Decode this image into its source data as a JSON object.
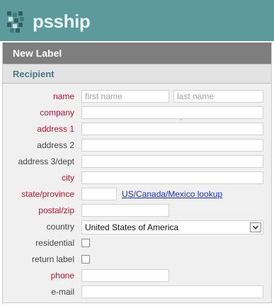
{
  "header": {
    "logo_text": "psship"
  },
  "panel": {
    "title": "New Label"
  },
  "recipient": {
    "section_label": "Recipient",
    "fields": {
      "name": {
        "label": "name",
        "first_placeholder": "first name",
        "last_placeholder": "last name",
        "first_value": "",
        "last_value": ""
      },
      "company": {
        "label": "company",
        "value": ""
      },
      "address1": {
        "label": "address 1",
        "value": ""
      },
      "address2": {
        "label": "address 2",
        "value": ""
      },
      "address3": {
        "label": "address 3/dept",
        "value": ""
      },
      "city": {
        "label": "city",
        "value": ""
      },
      "state": {
        "label": "state/province",
        "value": "",
        "lookup_link": "US/Canada/Mexico lookup"
      },
      "postal": {
        "label": "postal/zip",
        "value": ""
      },
      "country": {
        "label": "country",
        "value": "United States of America"
      },
      "residential": {
        "label": "residential",
        "checked": false
      },
      "return_label": {
        "label": "return label",
        "checked": false
      },
      "phone": {
        "label": "phone",
        "value": ""
      },
      "email": {
        "label": "e-mail",
        "value": ""
      }
    }
  },
  "colors": {
    "header_bg": "#5d9a9b",
    "panel_title_bg": "#7e7e7e",
    "required_label": "#c8102e",
    "link": "#1f32c8",
    "subsection_text": "#467a84"
  },
  "icons": {
    "logo": "psship-logo-mark",
    "select_arrow": "chevron-down-icon"
  }
}
